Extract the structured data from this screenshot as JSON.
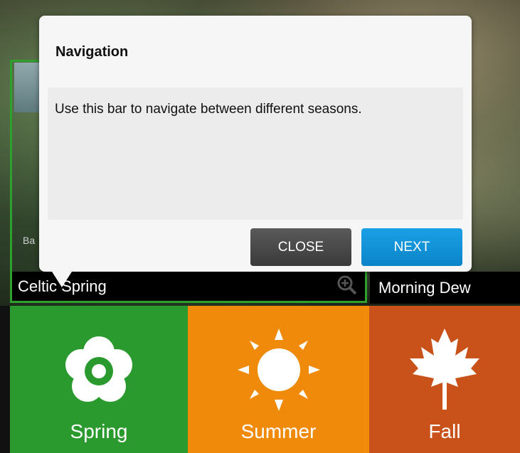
{
  "popup": {
    "title": "Navigation",
    "message": "Use this bar to navigate between different seasons.",
    "close_label": "CLOSE",
    "next_label": "NEXT"
  },
  "tiles": {
    "left_caption": "Celtic Spring",
    "right_caption": "Morning Dew",
    "side_text": "Ba"
  },
  "seasons": [
    {
      "label": "Spring",
      "icon": "flower-icon",
      "color": "#2a9a2e"
    },
    {
      "label": "Summer",
      "icon": "sun-icon",
      "color": "#f08a0a"
    },
    {
      "label": "Fall",
      "icon": "maple-leaf-icon",
      "color": "#c8521a"
    }
  ],
  "colors": {
    "accent_next": "#1aa0e6",
    "close_button": "#4a4a4a",
    "selected_border": "#2ea02e"
  }
}
